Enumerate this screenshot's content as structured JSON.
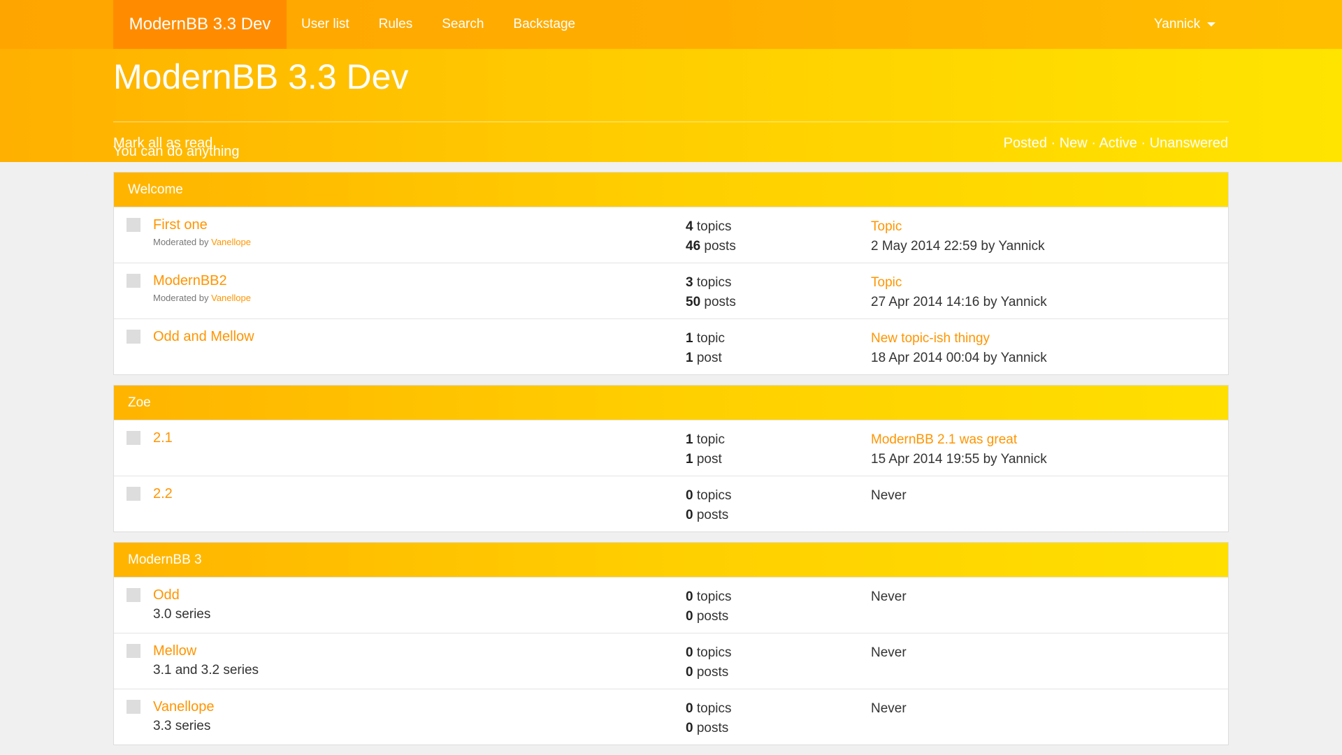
{
  "nav": {
    "brand": "ModernBB 3.3 Dev",
    "items": [
      "User list",
      "Rules",
      "Search",
      "Backstage"
    ],
    "user": "Yannick"
  },
  "hero": {
    "title": "ModernBB 3.3 Dev",
    "tagline": "You can do anything",
    "mark_read": "Mark all as read",
    "filters": [
      "Posted",
      "New",
      "Active",
      "Unanswered"
    ],
    "filter_separator": "·"
  },
  "sections": [
    {
      "title": "Welcome",
      "forums": [
        {
          "name": "First one",
          "moderated_label": "Moderated by",
          "moderator": "Vanellope",
          "topics": "4",
          "topics_label": "topics",
          "posts": "46",
          "posts_label": "posts",
          "last_topic": "Topic",
          "last_info": "2 May 2014 22:59 by Yannick"
        },
        {
          "name": "ModernBB2",
          "moderated_label": "Moderated by",
          "moderator": "Vanellope",
          "topics": "3",
          "topics_label": "topics",
          "posts": "50",
          "posts_label": "posts",
          "last_topic": "Topic",
          "last_info": "27 Apr 2014 14:16 by Yannick"
        },
        {
          "name": "Odd and Mellow",
          "topics": "1",
          "topics_label": "topic",
          "posts": "1",
          "posts_label": "post",
          "last_topic": "New topic-ish thingy",
          "last_info": "18 Apr 2014 00:04 by Yannick"
        }
      ]
    },
    {
      "title": "Zoe",
      "forums": [
        {
          "name": "2.1",
          "topics": "1",
          "topics_label": "topic",
          "posts": "1",
          "posts_label": "post",
          "last_topic": "ModernBB 2.1 was great",
          "last_info": "15 Apr 2014 19:55 by Yannick"
        },
        {
          "name": "2.2",
          "topics": "0",
          "topics_label": "topics",
          "posts": "0",
          "posts_label": "posts",
          "last_info": "Never"
        }
      ]
    },
    {
      "title": "ModernBB 3",
      "forums": [
        {
          "name": "Odd",
          "description": "3.0 series",
          "topics": "0",
          "topics_label": "topics",
          "posts": "0",
          "posts_label": "posts",
          "last_info": "Never"
        },
        {
          "name": "Mellow",
          "description": "3.1 and 3.2 series",
          "topics": "0",
          "topics_label": "topics",
          "posts": "0",
          "posts_label": "posts",
          "last_info": "Never"
        },
        {
          "name": "Vanellope",
          "description": "3.3 series",
          "topics": "0",
          "topics_label": "topics",
          "posts": "0",
          "posts_label": "posts",
          "last_info": "Never"
        }
      ]
    }
  ]
}
